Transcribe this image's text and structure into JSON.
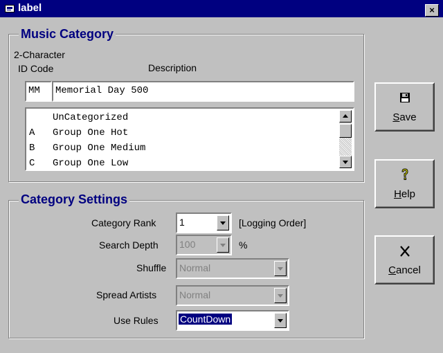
{
  "window": {
    "title": "label",
    "close_label": "×"
  },
  "music_category": {
    "group_title": "Music Category",
    "id_header_line1": "2-Character",
    "id_header_line2": "ID Code",
    "description_header": "Description",
    "id_value": "MM",
    "description_value": "Memorial Day 500",
    "list": [
      {
        "code": "",
        "name": "UnCategorized"
      },
      {
        "code": "A",
        "name": "Group One Hot"
      },
      {
        "code": "B",
        "name": "Group One Medium"
      },
      {
        "code": "C",
        "name": "Group One Low"
      }
    ]
  },
  "category_settings": {
    "group_title": "Category Settings",
    "category_rank": {
      "label": "Category Rank",
      "value": "1",
      "suffix": "[Logging Order]"
    },
    "search_depth": {
      "label": "Search Depth",
      "value": "100",
      "suffix": "%"
    },
    "shuffle": {
      "label": "Shuffle",
      "value": "Normal"
    },
    "spread_artists": {
      "label": "Spread Artists",
      "value": "Normal"
    },
    "use_rules": {
      "label": "Use Rules",
      "value": "CountDown"
    }
  },
  "buttons": {
    "save": {
      "mnemonic": "S",
      "rest": "ave"
    },
    "help": {
      "mnemonic": "H",
      "rest": "elp"
    },
    "cancel": {
      "mnemonic": "C",
      "rest": "ancel"
    }
  },
  "icons": {
    "save": "floppy-disk-icon",
    "help": "question-mark-icon",
    "cancel": "x-mark-icon"
  },
  "colors": {
    "title_bar": "#000080",
    "group_title": "#000080",
    "face": "#c0c0c0"
  }
}
